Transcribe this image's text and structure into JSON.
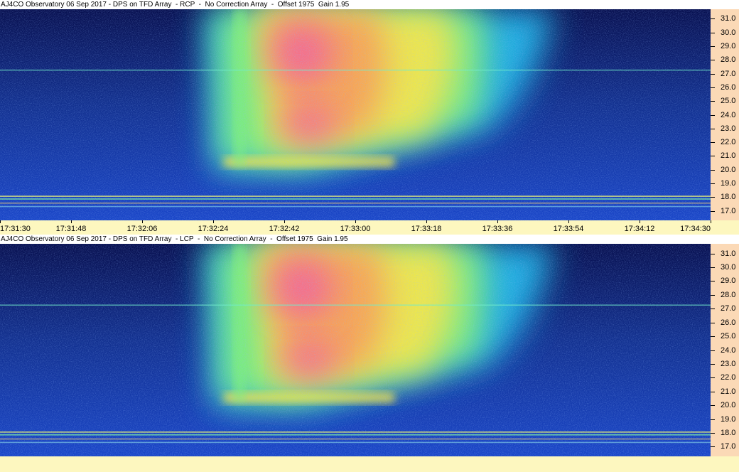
{
  "panels": [
    {
      "title": "AJ4CO Observatory 06 Sep 2017 - DPS on TFD Array  - RCP  -  No Correction Array  -  Offset 1975  Gain 1.95",
      "polarization": "RCP"
    },
    {
      "title": "AJ4CO Observatory 06 Sep 2017 - DPS on TFD Array  - LCP  -  No Correction Array  -  Offset 1975  Gain 1.95",
      "polarization": "LCP"
    }
  ],
  "chart_data": {
    "type": "heatmap",
    "x_ticks": [
      "17:31:30",
      "17:31:48",
      "17:32:06",
      "17:32:24",
      "17:32:42",
      "17:33:00",
      "17:33:18",
      "17:33:36",
      "17:33:54",
      "17:34:12",
      "17:34:30"
    ],
    "y_ticks": [
      "31.0",
      "30.0",
      "29.0",
      "28.0",
      "27.0",
      "26.0",
      "25.0",
      "24.0",
      "23.0",
      "22.0",
      "21.0",
      "20.0",
      "19.0",
      "18.0",
      "17.0"
    ],
    "y_range": [
      16.3,
      31.7
    ],
    "colormap": [
      "#081050",
      "#1a46c8",
      "#22b6e8",
      "#7ff07a",
      "#f5e64a",
      "#fb9d55",
      "#f55aa0"
    ],
    "burst": {
      "onset_time": "17:32:24",
      "peak_time": "17:32:42",
      "peak_freq": 23.0,
      "low_edge_freq": 20.3,
      "decay_end_time": "17:33:36"
    }
  }
}
